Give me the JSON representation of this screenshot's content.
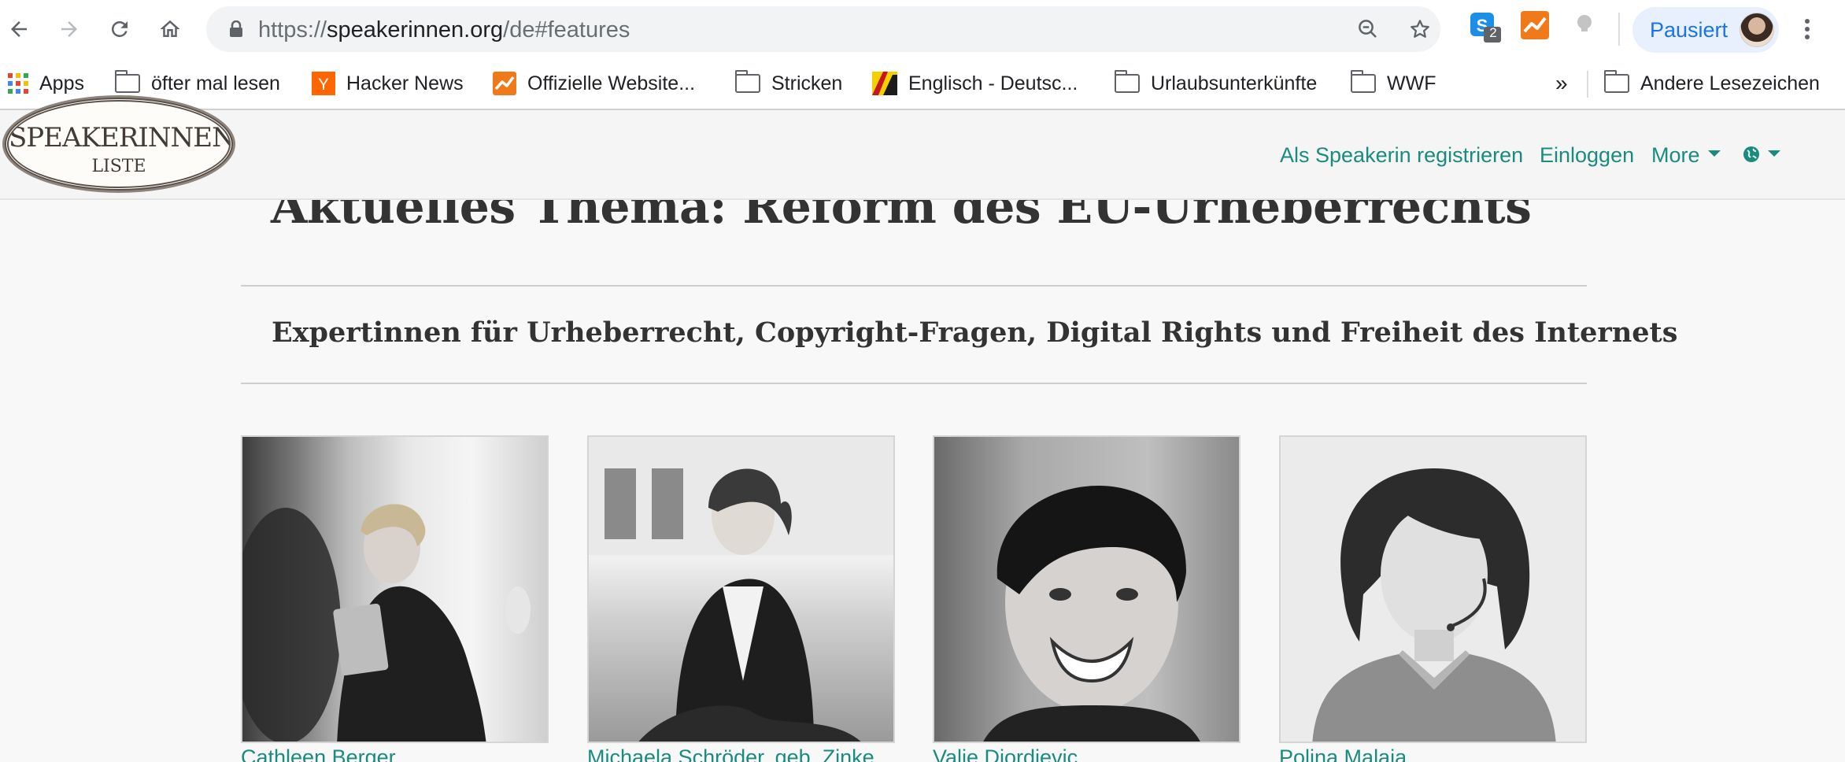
{
  "browser": {
    "url_scheme": "https://",
    "url_host": "speakerinnen.org",
    "url_path": "/de#features",
    "extension_badge": "2",
    "profile_label": "Pausiert",
    "bookmarks": [
      {
        "label": "Apps",
        "icon": "apps-grid-icon"
      },
      {
        "label": "öfter mal lesen",
        "icon": "folder-icon"
      },
      {
        "label": "Hacker News",
        "icon": "hacker-news-icon"
      },
      {
        "label": "Offizielle Website...",
        "icon": "chart-favicon"
      },
      {
        "label": "Stricken",
        "icon": "folder-icon"
      },
      {
        "label": "Englisch - Deutsc...",
        "icon": "dictionary-favicon"
      },
      {
        "label": "Urlaubsunterkünfte",
        "icon": "folder-icon"
      },
      {
        "label": "WWF",
        "icon": "folder-icon"
      }
    ],
    "overflow_label": "»",
    "other_bookmarks": "Andere Lesezeichen"
  },
  "site": {
    "logo_line1": "SPEAKERINNEN",
    "logo_line2": "LISTE",
    "nav": {
      "register": "Als Speakerin registrieren",
      "login": "Einloggen",
      "more": "More"
    }
  },
  "main": {
    "headline": "Aktuelles Thema: Reform des EU-Urheberrechts",
    "subheadline": "Expertinnen für Urheberrecht, Copyright-Fragen, Digital Rights und Freiheit des Internets",
    "speakers": [
      {
        "name": "Cathleen Berger"
      },
      {
        "name": "Michaela Schröder, geb. Zinke"
      },
      {
        "name": "Valie Djordjevic"
      },
      {
        "name": "Polina Malaja"
      }
    ]
  },
  "colors": {
    "link": "#1a8c7e",
    "profile_accent": "#1a73e8"
  }
}
